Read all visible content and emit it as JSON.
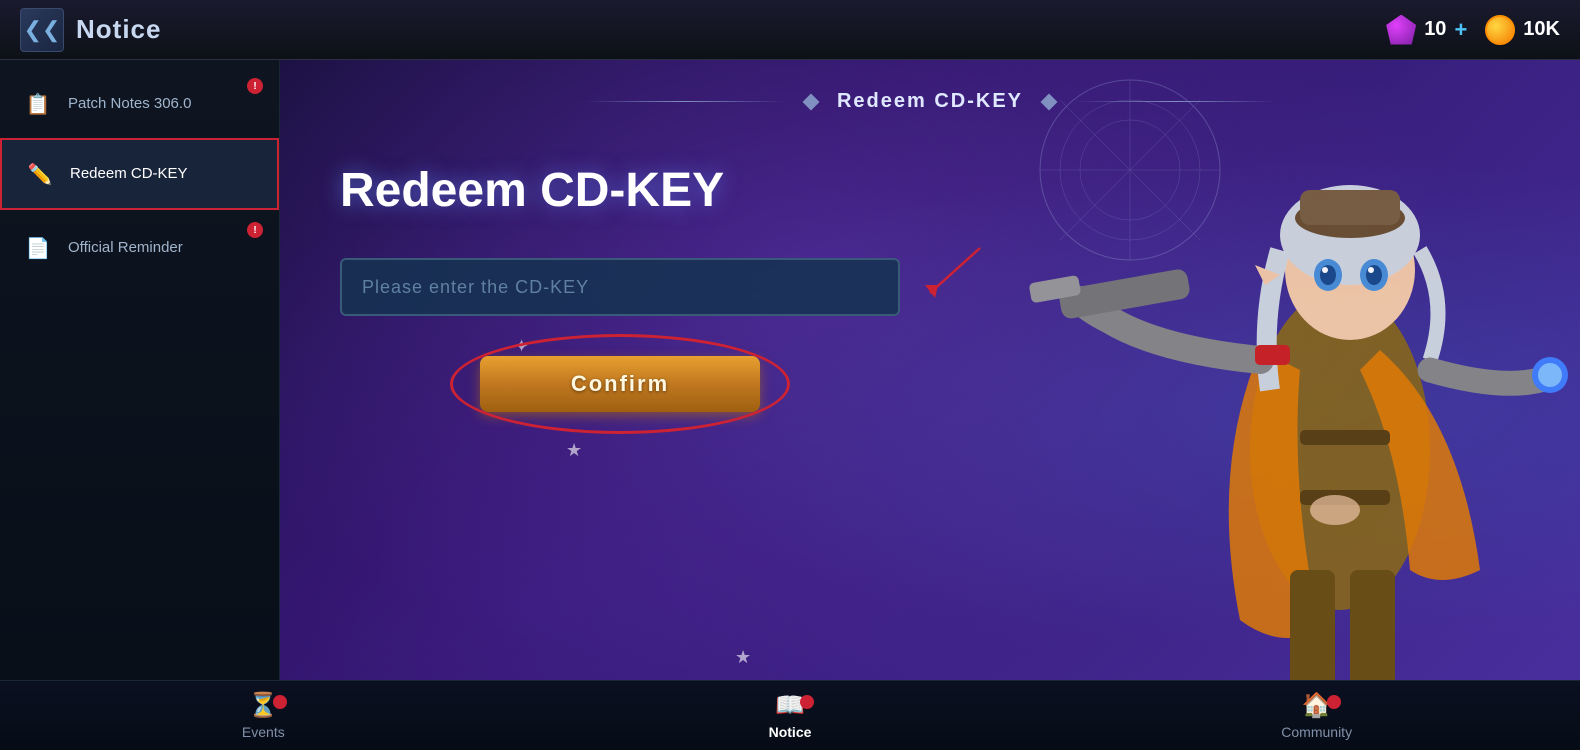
{
  "header": {
    "back_label": "◀",
    "title": "Notice",
    "gem_count": "10",
    "coin_count": "10K",
    "plus_label": "+"
  },
  "sidebar": {
    "items": [
      {
        "id": "patch-notes",
        "label": "Patch Notes 306.0",
        "icon": "📋",
        "active": false,
        "badge": true
      },
      {
        "id": "redeem-cdkey",
        "label": "Redeem CD-KEY",
        "icon": "✏️",
        "active": true,
        "badge": false
      },
      {
        "id": "official-reminder",
        "label": "Official Reminder",
        "icon": "📄",
        "active": false,
        "badge": true
      }
    ]
  },
  "content": {
    "section_title": "Redeem CD-KEY",
    "main_heading": "Redeem CD-KEY",
    "input_placeholder": "Please enter the CD-KEY",
    "confirm_label": "Confirm"
  },
  "bottom_nav": {
    "items": [
      {
        "id": "events",
        "label": "Events",
        "icon": "⏳",
        "active": false,
        "badge": true
      },
      {
        "id": "notice",
        "label": "Notice",
        "icon": "📖",
        "active": true,
        "badge": true
      },
      {
        "id": "community",
        "label": "Community",
        "icon": "🏠",
        "active": false,
        "badge": true
      }
    ]
  },
  "colors": {
    "active_border": "#cc2233",
    "confirm_bg": "#c07820",
    "gem_color": "#ab47bc",
    "coin_color": "#ffa726"
  }
}
